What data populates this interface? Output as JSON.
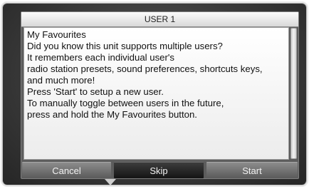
{
  "dialog": {
    "title": "USER 1",
    "body_lines": [
      "My Favourites",
      "Did you know this unit supports multiple users?",
      "It remembers each individual user's",
      "radio station presets, sound preferences, shortcuts keys,",
      "and much more!",
      "Press 'Start' to setup a new user.",
      "To manually toggle between users in the future,",
      "press and hold the My Favourites button."
    ]
  },
  "buttons": {
    "cancel": "Cancel",
    "skip": "Skip",
    "start": "Start"
  },
  "colors": {
    "background": "#3a3a3a",
    "title_bar": "#e8e8e8",
    "body_panel": "#f5f5f5",
    "button": "#6e6e6e",
    "button_selected": "#222222"
  }
}
